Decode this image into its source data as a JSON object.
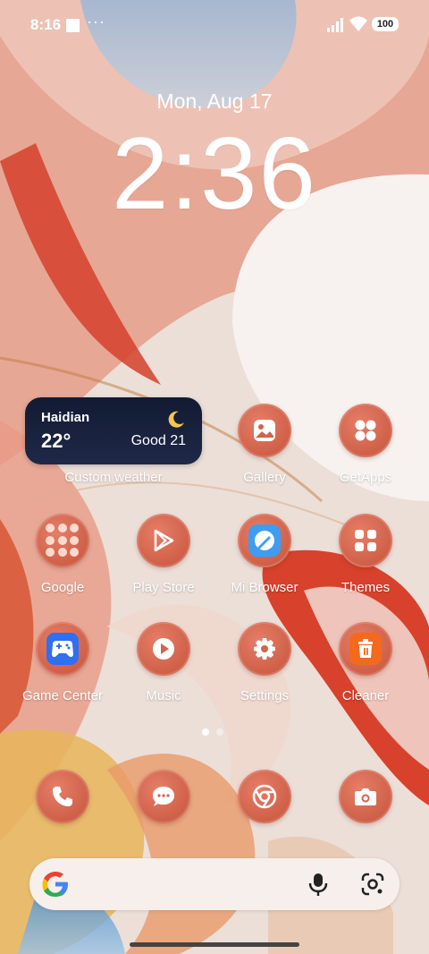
{
  "status_bar": {
    "time": "8:16",
    "dots": "···",
    "battery": "100"
  },
  "lockscreen": {
    "date": "Mon, Aug 17",
    "clock": "2:36"
  },
  "weather_widget": {
    "city": "Haidian",
    "temperature": "22°",
    "air_quality": "Good 21",
    "label": "Custom weather"
  },
  "apps": {
    "gallery": "Gallery",
    "getapps": "GetApps",
    "google": "Google",
    "play_store": "Play Store",
    "mi_browser": "Mi Browser",
    "themes": "Themes",
    "game_center": "Game Center",
    "music": "Music",
    "settings": "Settings",
    "cleaner": "Cleaner"
  },
  "dock": [
    "phone-icon",
    "messages-icon",
    "chrome-icon",
    "camera-icon"
  ],
  "page_indicator": {
    "pages": 2,
    "current": 1
  },
  "colors": {
    "icon_bg": "#d0644c",
    "search_bg": "#f6efec",
    "widget_bg": "#151d38"
  }
}
